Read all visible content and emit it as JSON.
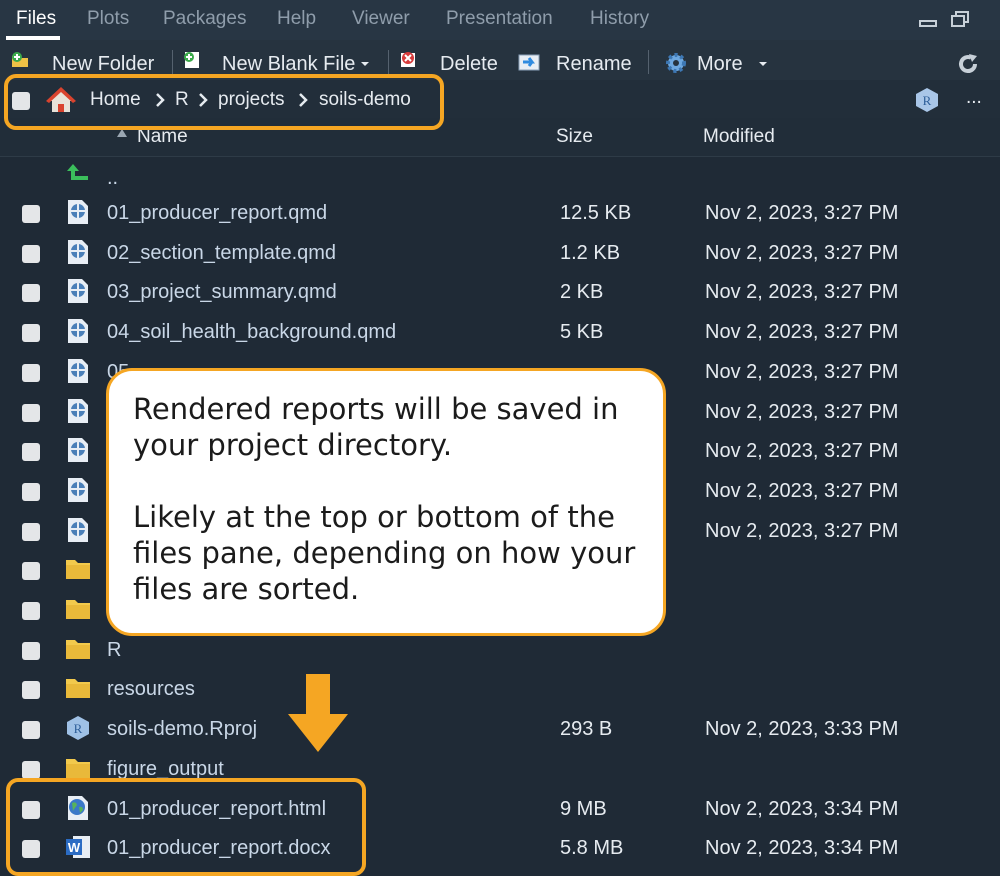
{
  "tabs": [
    "Files",
    "Plots",
    "Packages",
    "Help",
    "Viewer",
    "Presentation",
    "History"
  ],
  "toolbar": {
    "new_folder": "New Folder",
    "new_blank_file": "New Blank File",
    "delete": "Delete",
    "rename": "Rename",
    "more": "More"
  },
  "breadcrumb": [
    "Home",
    "R",
    "projects",
    "soils-demo"
  ],
  "overflow_label": "...",
  "columns": {
    "name": "Name",
    "size": "Size",
    "modified": "Modified"
  },
  "parent_dir": "..",
  "files": [
    {
      "name": "01_producer_report.qmd",
      "size": "12.5 KB",
      "modified": "Nov 2, 2023, 3:27 PM",
      "icon": "quarto-doc-icon"
    },
    {
      "name": "02_section_template.qmd",
      "size": "1.2 KB",
      "modified": "Nov 2, 2023, 3:27 PM",
      "icon": "quarto-doc-icon"
    },
    {
      "name": "03_project_summary.qmd",
      "size": "2 KB",
      "modified": "Nov 2, 2023, 3:27 PM",
      "icon": "quarto-doc-icon"
    },
    {
      "name": "04_soil_health_background.qmd",
      "size": "5 KB",
      "modified": "Nov 2, 2023, 3:27 PM",
      "icon": "quarto-doc-icon"
    },
    {
      "name": "05",
      "size": "",
      "modified": "Nov 2, 2023, 3:27 PM",
      "icon": "quarto-doc-icon"
    },
    {
      "name": "",
      "size": "",
      "modified": "Nov 2, 2023, 3:27 PM",
      "icon": "quarto-doc-icon"
    },
    {
      "name": "",
      "size": "",
      "modified": "Nov 2, 2023, 3:27 PM",
      "icon": "quarto-doc-icon"
    },
    {
      "name": "",
      "size": "",
      "modified": "Nov 2, 2023, 3:27 PM",
      "icon": "quarto-doc-icon"
    },
    {
      "name": "",
      "size": "",
      "modified": "Nov 2, 2023, 3:27 PM",
      "icon": "quarto-doc-icon"
    },
    {
      "name": "",
      "size": "",
      "modified": "",
      "icon": "folder-icon"
    },
    {
      "name": "",
      "size": "",
      "modified": "",
      "icon": "folder-icon"
    },
    {
      "name": "R",
      "size": "",
      "modified": "",
      "icon": "folder-icon"
    },
    {
      "name": "resources",
      "size": "",
      "modified": "",
      "icon": "folder-icon"
    },
    {
      "name": "soils-demo.Rproj",
      "size": "293 B",
      "modified": "Nov 2, 2023, 3:33 PM",
      "icon": "rproj-icon"
    },
    {
      "name": "figure_output",
      "size": "",
      "modified": "",
      "icon": "folder-icon"
    },
    {
      "name": "01_producer_report.html",
      "size": "9 MB",
      "modified": "Nov 2, 2023, 3:34 PM",
      "icon": "html-globe-icon"
    },
    {
      "name": "01_producer_report.docx",
      "size": "5.8 MB",
      "modified": "Nov 2, 2023, 3:34 PM",
      "icon": "word-doc-icon"
    }
  ],
  "callout": {
    "line1": "Rendered reports will be saved in your project directory.",
    "line2": "Likely at the top or bottom of the files pane, depending on how your files are sorted."
  },
  "colors": {
    "highlight": "#f5a623",
    "background": "#1f2a36",
    "filename": "#c9d7e7"
  }
}
